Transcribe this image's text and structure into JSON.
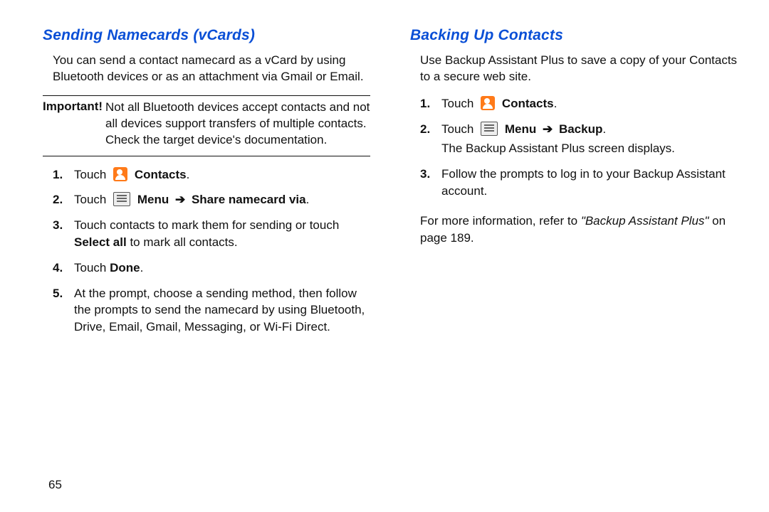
{
  "page_number": "65",
  "left": {
    "heading": "Sending Namecards (vCards)",
    "intro": "You can send a contact namecard as a vCard by using Bluetooth devices or as an attachment via Gmail or Email.",
    "important_label": "Important!",
    "important_text": "Not all Bluetooth devices accept contacts and not all devices support transfers of multiple contacts. Check the target device's documentation.",
    "steps": {
      "s1_a": "Touch",
      "s1_b": "Contacts",
      "s1_c": ".",
      "s2_a": "Touch",
      "s2_b": "Menu",
      "s2_arrow": "➔",
      "s2_c": "Share namecard via",
      "s2_d": ".",
      "s3_a": "Touch contacts to mark them for sending or touch ",
      "s3_b": "Select all",
      "s3_c": " to mark all contacts.",
      "s4_a": "Touch ",
      "s4_b": "Done",
      "s4_c": ".",
      "s5": "At the prompt, choose a sending method, then follow the prompts to send the namecard by using Bluetooth, Drive, Email, Gmail, Messaging, or Wi-Fi Direct."
    }
  },
  "right": {
    "heading": "Backing Up Contacts",
    "intro": "Use Backup Assistant Plus to save a copy of your Contacts to a secure web site.",
    "steps": {
      "s1_a": "Touch",
      "s1_b": "Contacts",
      "s1_c": ".",
      "s2_a": "Touch",
      "s2_b": "Menu",
      "s2_arrow": "➔",
      "s2_c": "Backup",
      "s2_d": ".",
      "s2_e": "The Backup Assistant Plus screen displays.",
      "s3": "Follow the prompts to log in to your Backup Assistant account."
    },
    "ref_a": "For more information, refer to ",
    "ref_b": "\"Backup Assistant Plus\"",
    "ref_c": " on page 189."
  }
}
